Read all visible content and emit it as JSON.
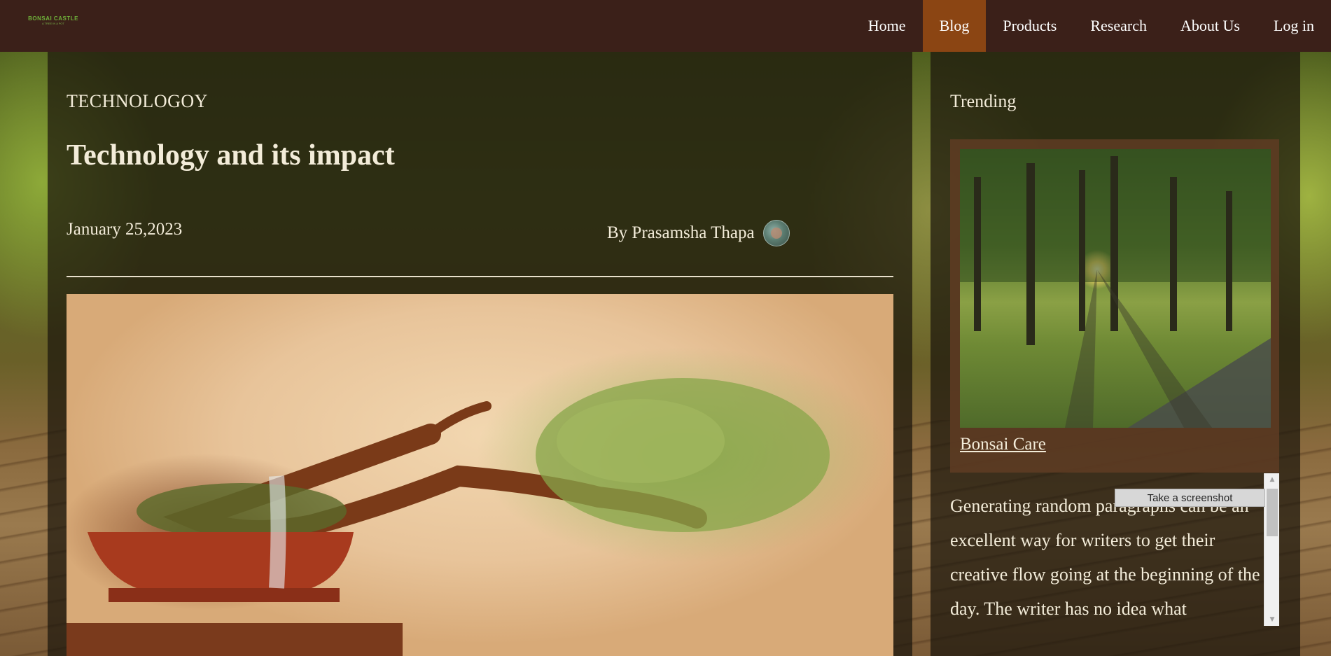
{
  "logo": {
    "name": "BONSAI CASTLE",
    "tagline": "A TREE IN A POT"
  },
  "nav": {
    "items": [
      {
        "label": "Home",
        "active": false
      },
      {
        "label": "Blog",
        "active": true
      },
      {
        "label": "Products",
        "active": false
      },
      {
        "label": "Research",
        "active": false
      },
      {
        "label": "About Us",
        "active": false
      },
      {
        "label": "Log in",
        "active": false
      }
    ]
  },
  "article": {
    "category": "TECHNOLOGOY",
    "title": "Technology and its impact",
    "date": "January 25,2023",
    "author": "By Prasamsha Thapa"
  },
  "sidebar": {
    "heading": "Trending",
    "card_link": "Bonsai Care",
    "excerpt": "Generating random paragraphs can be an excellent way for writers to get their creative flow going at the beginning of the day. The writer has no idea what"
  },
  "tooltip": "Take a screenshot",
  "colors": {
    "navbar": "#3b2019",
    "nav_active": "#8b4513",
    "text": "#f3ecd9",
    "card": "#5f3c23"
  }
}
